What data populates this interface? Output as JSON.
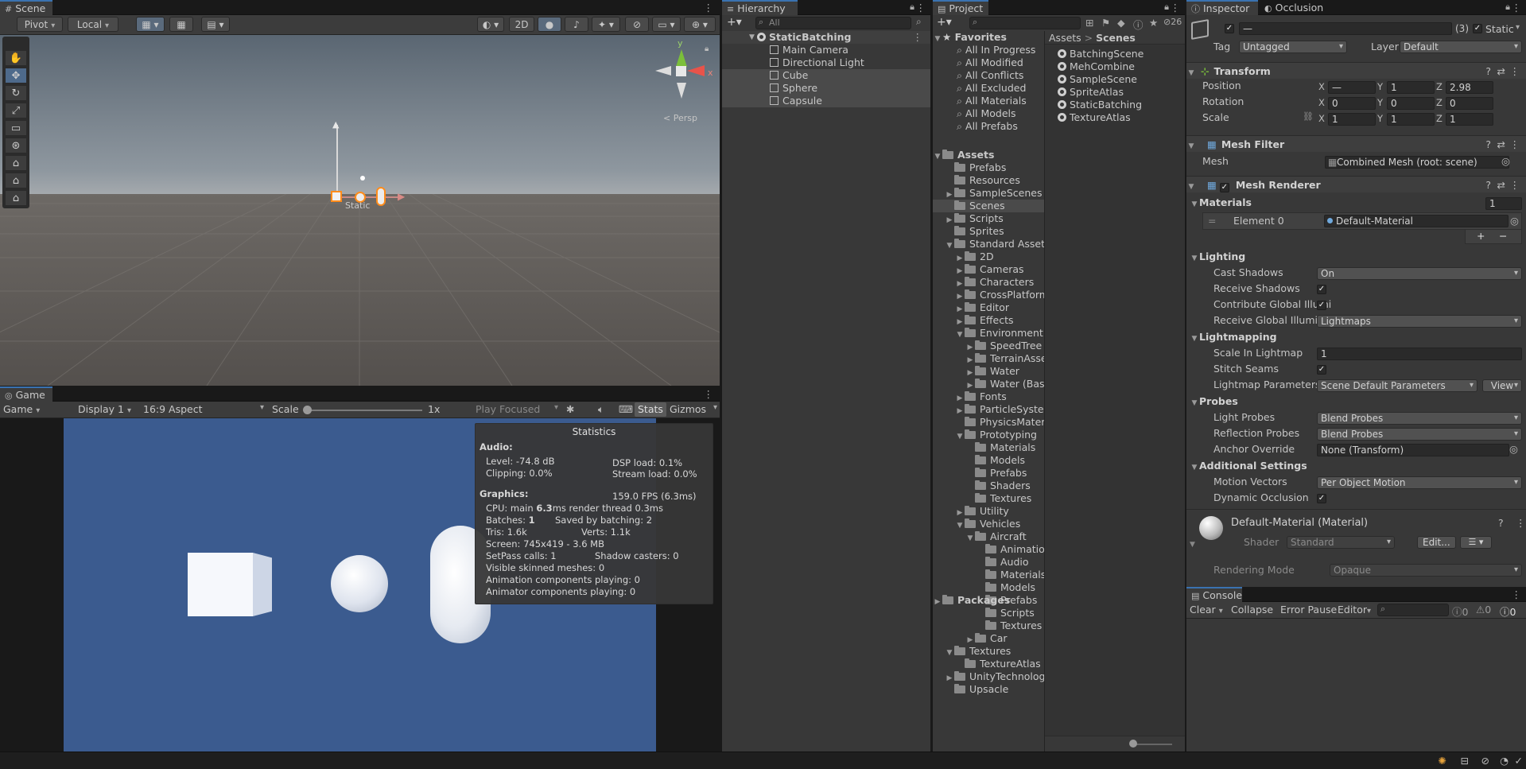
{
  "scene": {
    "tab": "Scene",
    "pivot": "Pivot",
    "local": "Local",
    "mode2d": "2D",
    "persp": "< Persp",
    "gizmo_x": "x",
    "gizmo_y": "y"
  },
  "game": {
    "tab": "Game",
    "mode": "Game",
    "display": "Display 1",
    "aspect": "16:9 Aspect",
    "scale_label": "Scale",
    "scale_value": "1x",
    "play_focused": "Play Focused",
    "stats": "Stats",
    "gizmos": "Gizmos",
    "scale_fraction": 0.0
  },
  "statistics": {
    "title": "Statistics",
    "audio_header": "Audio:",
    "level": "Level: -74.8 dB",
    "clipping": "Clipping: 0.0%",
    "dsp": "DSP load: 0.1%",
    "stream": "Stream load: 0.0%",
    "graphics_header": "Graphics:",
    "fps": "159.0 FPS (6.3ms)",
    "cpu_prefix": "CPU: main ",
    "cpu_main": "6.3",
    "cpu_suffix": "ms  render thread 0.3ms",
    "batches_prefix": "Batches: ",
    "batches": "1",
    "saved": "Saved by batching: 2",
    "tris": "Tris: 1.6k",
    "verts": "Verts: 1.1k",
    "screen": "Screen: 745x419 - 3.6 MB",
    "setpass": "SetPass calls: 1",
    "shadow": "Shadow casters: 0",
    "skinned": "Visible skinned meshes: 0",
    "anim": "Animation components playing: 0",
    "animator": "Animator components playing: 0"
  },
  "hierarchy": {
    "tab": "Hierarchy",
    "search_placeholder": "All",
    "scene": "StaticBatching",
    "items": [
      "Main Camera",
      "Directional Light",
      "Cube",
      "Sphere",
      "Capsule"
    ]
  },
  "project": {
    "tab": "Project",
    "hidden_count": "26",
    "favorites_header": "Favorites",
    "favorites": [
      "All In Progress",
      "All Modified",
      "All Conflicts",
      "All Excluded",
      "All Materials",
      "All Models",
      "All Prefabs"
    ],
    "assets_header": "Assets",
    "tree": [
      {
        "label": "Prefabs",
        "depth": 1,
        "fold": ""
      },
      {
        "label": "Resources",
        "depth": 1,
        "fold": ""
      },
      {
        "label": "SampleScenes",
        "depth": 1,
        "fold": "▶"
      },
      {
        "label": "Scenes",
        "depth": 1,
        "fold": ""
      },
      {
        "label": "Scripts",
        "depth": 1,
        "fold": "▶"
      },
      {
        "label": "Sprites",
        "depth": 1,
        "fold": ""
      },
      {
        "label": "Standard Assets",
        "depth": 1,
        "fold": "▼"
      },
      {
        "label": "2D",
        "depth": 2,
        "fold": "▶"
      },
      {
        "label": "Cameras",
        "depth": 2,
        "fold": "▶"
      },
      {
        "label": "Characters",
        "depth": 2,
        "fold": "▶"
      },
      {
        "label": "CrossPlatform",
        "depth": 2,
        "fold": "▶"
      },
      {
        "label": "Editor",
        "depth": 2,
        "fold": "▶"
      },
      {
        "label": "Effects",
        "depth": 2,
        "fold": "▶"
      },
      {
        "label": "Environment",
        "depth": 2,
        "fold": "▼"
      },
      {
        "label": "SpeedTree",
        "depth": 3,
        "fold": "▶"
      },
      {
        "label": "TerrainAsse",
        "depth": 3,
        "fold": "▶"
      },
      {
        "label": "Water",
        "depth": 3,
        "fold": "▶"
      },
      {
        "label": "Water (Basi",
        "depth": 3,
        "fold": "▶"
      },
      {
        "label": "Fonts",
        "depth": 2,
        "fold": "▶"
      },
      {
        "label": "ParticleSyster",
        "depth": 2,
        "fold": "▶"
      },
      {
        "label": "PhysicsMateri",
        "depth": 2,
        "fold": ""
      },
      {
        "label": "Prototyping",
        "depth": 2,
        "fold": "▼"
      },
      {
        "label": "Materials",
        "depth": 3,
        "fold": ""
      },
      {
        "label": "Models",
        "depth": 3,
        "fold": ""
      },
      {
        "label": "Prefabs",
        "depth": 3,
        "fold": ""
      },
      {
        "label": "Shaders",
        "depth": 3,
        "fold": ""
      },
      {
        "label": "Textures",
        "depth": 3,
        "fold": ""
      },
      {
        "label": "Utility",
        "depth": 2,
        "fold": "▶"
      },
      {
        "label": "Vehicles",
        "depth": 2,
        "fold": "▼"
      },
      {
        "label": "Aircraft",
        "depth": 3,
        "fold": "▼"
      },
      {
        "label": "Animatio",
        "depth": 4,
        "fold": ""
      },
      {
        "label": "Audio",
        "depth": 4,
        "fold": ""
      },
      {
        "label": "Materials",
        "depth": 4,
        "fold": ""
      },
      {
        "label": "Models",
        "depth": 4,
        "fold": ""
      },
      {
        "label": "Prefabs",
        "depth": 4,
        "fold": ""
      },
      {
        "label": "Scripts",
        "depth": 4,
        "fold": ""
      },
      {
        "label": "Textures",
        "depth": 4,
        "fold": ""
      },
      {
        "label": "Car",
        "depth": 3,
        "fold": "▶"
      },
      {
        "label": "Textures",
        "depth": 1,
        "fold": "▼"
      },
      {
        "label": "TextureAtlas",
        "depth": 2,
        "fold": ""
      },
      {
        "label": "UnityTechnologi",
        "depth": 1,
        "fold": "▶"
      },
      {
        "label": "Upsacle",
        "depth": 1,
        "fold": ""
      }
    ],
    "packages_header": "Packages",
    "breadcrumb_root": "Assets",
    "breadcrumb_sep": ">",
    "breadcrumb_current": "Scenes",
    "files": [
      "BatchingScene",
      "MehCombine",
      "SampleScene",
      "SpriteAtlas",
      "StaticBatching",
      "TextureAtlas"
    ]
  },
  "inspector": {
    "tab": "Inspector",
    "tab2": "Occlusion",
    "name_value": "—",
    "count": "(3)",
    "static_label": "Static",
    "tag_label": "Tag",
    "tag_value": "Untagged",
    "layer_label": "Layer",
    "layer_value": "Default",
    "transform": "Transform",
    "position": "Position",
    "rotation": "Rotation",
    "scale": "Scale",
    "pos": [
      "—",
      "1",
      "2.98"
    ],
    "rot": [
      "0",
      "0",
      "0"
    ],
    "scl": [
      "1",
      "1",
      "1"
    ],
    "axes": [
      "X",
      "Y",
      "Z"
    ],
    "mesh_filter": "Mesh Filter",
    "mesh_label": "Mesh",
    "mesh_value": "Combined Mesh (root: scene)",
    "mesh_renderer": "Mesh Renderer",
    "materials": "Materials",
    "materials_count": "1",
    "element0": "Element 0",
    "element0_value": "Default-Material",
    "plus": "+",
    "minus": "−",
    "lighting": "Lighting",
    "cast_shadows": "Cast Shadows",
    "cast_shadows_value": "On",
    "receive_shadows": "Receive Shadows",
    "contribute_gi": "Contribute Global Illumi",
    "receive_gi": "Receive Global Illumina",
    "receive_gi_value": "Lightmaps",
    "lightmapping": "Lightmapping",
    "scale_in_lightmap": "Scale In Lightmap",
    "scale_in_lightmap_value": "1",
    "stitch_seams": "Stitch Seams",
    "lightmap_params": "Lightmap Parameters",
    "lightmap_params_value": "Scene Default Parameters",
    "view": "View",
    "probes": "Probes",
    "light_probes": "Light Probes",
    "light_probes_value": "Blend Probes",
    "reflection_probes": "Reflection Probes",
    "reflection_probes_value": "Blend Probes",
    "anchor_override": "Anchor Override",
    "anchor_override_value": "None (Transform)",
    "additional": "Additional Settings",
    "motion_vectors": "Motion Vectors",
    "motion_vectors_value": "Per Object Motion",
    "dynamic_occlusion": "Dynamic Occlusion",
    "material_name": "Default-Material (Material)",
    "shader_label": "Shader",
    "shader_value": "Standard",
    "edit": "Edit...",
    "rendering_mode": "Rendering Mode",
    "rendering_mode_value": "Opaque"
  },
  "console": {
    "tab": "Console",
    "clear": "Clear",
    "collapse": "Collapse",
    "error_pause": "Error Pause",
    "editor": "Editor",
    "info_count": "0",
    "warn_count": "0",
    "err_count": "0"
  },
  "colors": {
    "accent": "#3a72b0",
    "selection": "#2c5d87",
    "game_bg": "#3b5b8f"
  }
}
